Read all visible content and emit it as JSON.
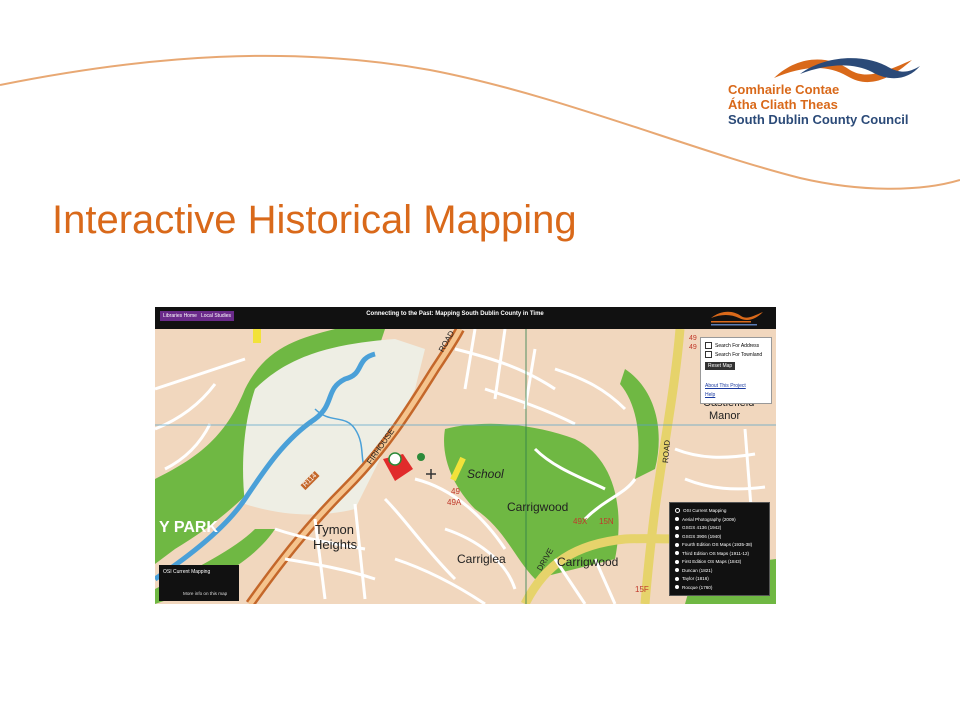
{
  "slide": {
    "title": "Interactive Historical Mapping",
    "logo": {
      "line1": "Comhairle Contae",
      "line2": "Átha Cliath Theas",
      "line3": "South Dublin County Council"
    }
  },
  "app": {
    "nav": [
      "Libraries Home",
      "Local Studies"
    ],
    "title": "Connecting to the Past: Mapping South Dublin County in Time",
    "search_panel": {
      "search_address": "Search For Address",
      "search_townland": "Search For Townland",
      "reset": "Reset Map",
      "about": "About This Project",
      "help": "Help"
    },
    "layers": {
      "options": [
        "OSI Current Mapping",
        "Aerial Photography (2009)",
        "GSGS 4136 (1942)",
        "GSGS 3906 (1940)",
        "Fourth Edition OS Maps (1935-38)",
        "Third Edition OS Maps (1911-12)",
        "First Edition OS Maps (1843)",
        "Duncan (1821)",
        "Taylor (1816)",
        "Rocque (1760)"
      ],
      "selected": "OSI Current Mapping"
    },
    "info_box": {
      "title": "OSI Current Mapping",
      "more": "More info on this map"
    },
    "map_labels": {
      "tymon": "Tymon",
      "heights": "Heights",
      "carrigwood1": "Carrigwood",
      "carrigwood2": "Carrigwood",
      "carriglea": "Carriglea",
      "school": "School",
      "castlefield": "Castlefield",
      "manor": "Manor",
      "park": "Y PARK",
      "r114": "R114",
      "road_fir": "FIRHOUSE",
      "road_road": "ROAD",
      "road_drive": "DRIVE",
      "road_road2": "ROAD",
      "bus_49": "49",
      "bus_49a": "49A",
      "bus_49x": "49X",
      "bus_15n": "15N",
      "bus_15f": "15F",
      "bus_49b": "49",
      "bus_49c": "49"
    },
    "colors": {
      "accent": "#d9691a",
      "navy": "#2b4a78",
      "purple": "#6a2a8a",
      "green_area": "#6fb843",
      "land": "#f1d7be",
      "water": "#4aa0d8"
    }
  }
}
